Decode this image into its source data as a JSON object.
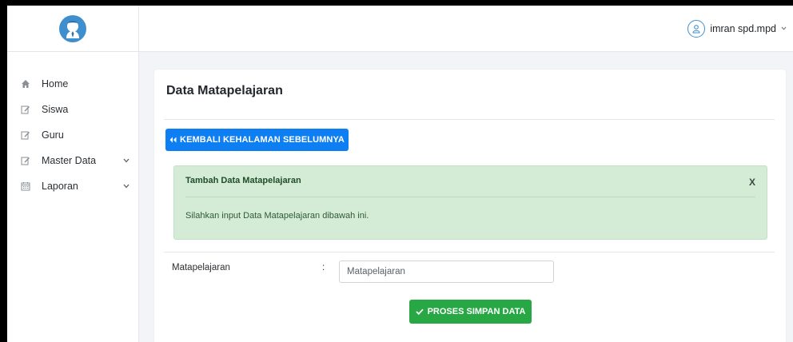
{
  "sidebar": {
    "logo": "user-tie-avatar",
    "items": [
      {
        "label": "Home",
        "icon": "home-icon",
        "has_submenu": false
      },
      {
        "label": "Siswa",
        "icon": "edit-icon",
        "has_submenu": false
      },
      {
        "label": "Guru",
        "icon": "edit-icon",
        "has_submenu": false
      },
      {
        "label": "Master Data",
        "icon": "edit-icon",
        "has_submenu": true
      },
      {
        "label": "Laporan",
        "icon": "calendar-icon",
        "has_submenu": true
      }
    ]
  },
  "header": {
    "user_name": "imran spd.mpd",
    "user_icon": "user-circle-icon"
  },
  "main": {
    "page_title": "Data Matapelajaran",
    "back_button": "KEMBALI KEHALAMAN SEBELUMNYA",
    "alert": {
      "title": "Tambah Data Matapelajaran",
      "close": "X",
      "message": "Silahkan input Data Matapelajaran dibawah ini."
    },
    "form": {
      "field_label": "Matapelajaran",
      "separator": ":",
      "field_placeholder": "Matapelajaran",
      "field_value": ""
    },
    "submit_button": "PROSES SIMPAN DATA"
  },
  "colors": {
    "primary": "#0d7ff2",
    "success": "#28a745",
    "alert_bg": "#d4ecd6",
    "accent": "#3f8fcf"
  }
}
